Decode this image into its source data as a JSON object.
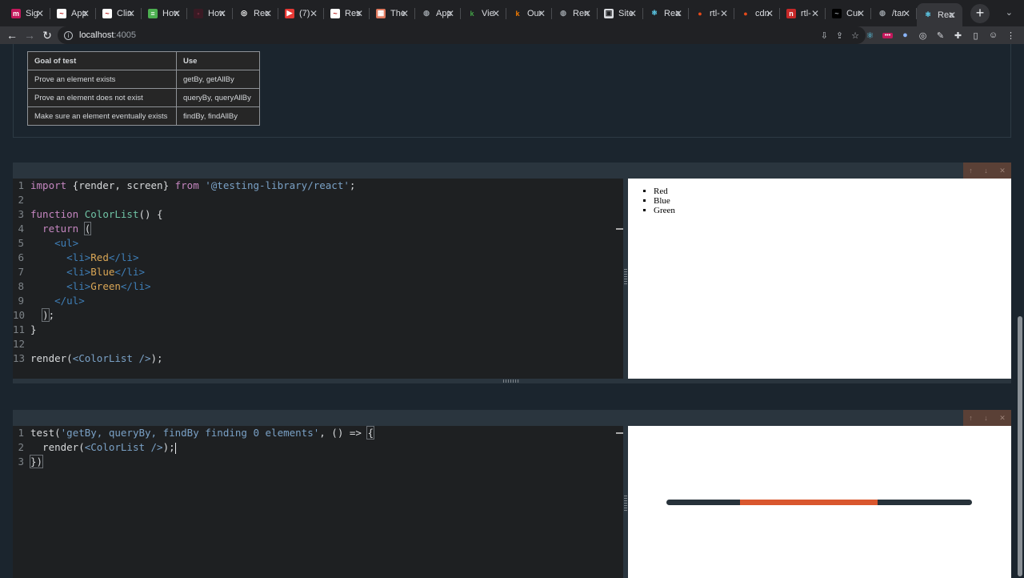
{
  "browser": {
    "tabs": [
      {
        "title": "Sig",
        "icon": "m",
        "icon_color": "#c2185b",
        "icon_fg": "#ffffff"
      },
      {
        "title": "App",
        "icon": "~",
        "icon_color": "#ffffff",
        "icon_fg": "#b71c1c"
      },
      {
        "title": "Clin",
        "icon": "~",
        "icon_color": "#ffffff",
        "icon_fg": "#b71c1c"
      },
      {
        "title": "How",
        "icon": "≡",
        "icon_color": "#4caf50",
        "icon_fg": "#ffffff"
      },
      {
        "title": "How",
        "icon": "•",
        "icon_color": "#3a1a24",
        "icon_fg": "#6a2a3a"
      },
      {
        "title": "Rec",
        "icon": "◎",
        "icon_color": "#202124",
        "icon_fg": "#ffffff"
      },
      {
        "title": "(7)",
        "icon": "▶",
        "icon_color": "#e53935",
        "icon_fg": "#ffffff"
      },
      {
        "title": "Res",
        "icon": "~",
        "icon_color": "#ffffff",
        "icon_fg": "#b71c1c"
      },
      {
        "title": "The",
        "icon": "▦",
        "icon_color": "#e07a5f",
        "icon_fg": "#ffffff"
      },
      {
        "title": "App",
        "icon": "◍",
        "icon_color": "#202124",
        "icon_fg": "#9aa0a6"
      },
      {
        "title": "Vie",
        "icon": "k",
        "icon_color": "#202124",
        "icon_fg": "#43a047"
      },
      {
        "title": "Our",
        "icon": "k",
        "icon_color": "#202124",
        "icon_fg": "#f57c00"
      },
      {
        "title": "Ren",
        "icon": "◍",
        "icon_color": "#202124",
        "icon_fg": "#9aa0a6"
      },
      {
        "title": "Site",
        "icon": "▣",
        "icon_color": "#dadce0",
        "icon_fg": "#202124"
      },
      {
        "title": "Rea",
        "icon": "⚛",
        "icon_color": "#202124",
        "icon_fg": "#61dafb"
      },
      {
        "title": "rtl-",
        "icon": "●",
        "icon_color": "#202124",
        "icon_fg": "#e64a19"
      },
      {
        "title": "cdn",
        "icon": "●",
        "icon_color": "#202124",
        "icon_fg": "#e64a19"
      },
      {
        "title": "rtl-",
        "icon": "n",
        "icon_color": "#c62828",
        "icon_fg": "#ffffff"
      },
      {
        "title": "Cur",
        "icon": "~",
        "icon_color": "#000000",
        "icon_fg": "#9aa0a6"
      },
      {
        "title": "/tar",
        "icon": "◍",
        "icon_color": "#202124",
        "icon_fg": "#9aa0a6"
      },
      {
        "title": "Rea",
        "icon": "⚛",
        "icon_color": "#35363a",
        "icon_fg": "#61dafb",
        "active": true
      }
    ],
    "new_tab_label": "+",
    "tab_menu_icon": "⌄",
    "close_glyph": "✕",
    "url_host": "localhost",
    "url_port": ":4005",
    "nav": {
      "back": "←",
      "forward": "→",
      "reload": "↻"
    }
  },
  "guide_table": {
    "headers": [
      "Goal of test",
      "Use"
    ],
    "rows": [
      [
        "Prove an element exists",
        "getBy, getAllBy"
      ],
      [
        "Prove an element does not exist",
        "queryBy, queryAllBy"
      ],
      [
        "Make sure an element eventually exists",
        "findBy, findAllBy"
      ]
    ]
  },
  "block_controls": {
    "up": "↑",
    "down": "↓",
    "close": "✕"
  },
  "editor1": {
    "line_numbers": [
      "1",
      "2",
      "3",
      "4",
      "5",
      "6",
      "7",
      "8",
      "9",
      "10",
      "11",
      "12",
      "13"
    ],
    "tokens": {
      "import": "import",
      "import_names": " {render, screen} ",
      "from": "from",
      "module": " '@testing-library/react'",
      "semicolon": ";",
      "function_kw": "function",
      "component": " ColorList",
      "sig": "() {",
      "return_kw": "  return ",
      "open_paren": "(",
      "ul_open": "    <ul>",
      "li_open": "<li>",
      "li_close": "</li>",
      "item_red": "Red",
      "item_blue": "Blue",
      "item_green": "Green",
      "ul_close": "    </ul>",
      "close_paren": ")",
      "close_brace": "}",
      "render_call": "render(",
      "jsx_colorlist": "<ColorList />",
      "render_end": ");"
    }
  },
  "preview1": {
    "items": [
      "Red",
      "Blue",
      "Green"
    ]
  },
  "editor2": {
    "line_numbers": [
      "1",
      "2",
      "3"
    ],
    "tokens": {
      "test_fn": "test(",
      "test_name": "'getBy, queryBy, findBy finding 0 elements'",
      "arrow": ", () => ",
      "open_brace": "{",
      "render_indent": "  render(",
      "jsx_colorlist": "<ColorList />",
      "render_end": ");",
      "close": "})"
    }
  },
  "preview2": {
    "loading_progress": {
      "start_fraction": 0.24,
      "end_fraction": 0.69
    },
    "colors": {
      "track": "#27323a",
      "fill": "#d9572e"
    }
  }
}
